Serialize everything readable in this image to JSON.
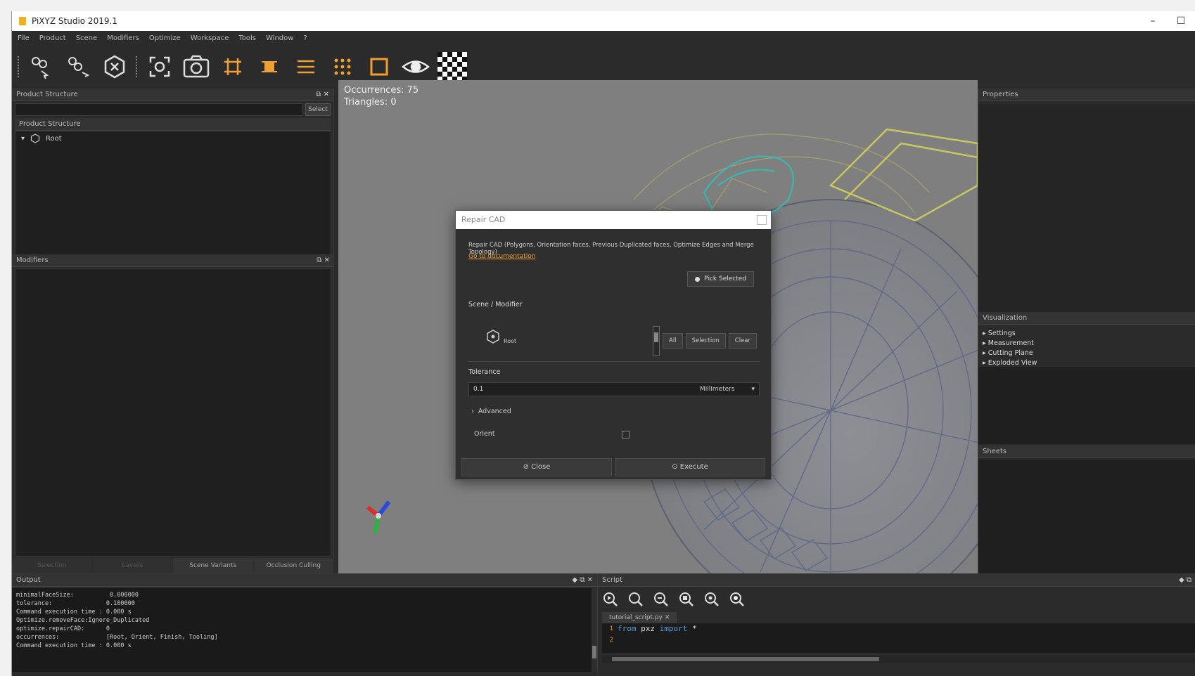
{
  "window": {
    "title": "PiXYZ Studio 2019.1"
  },
  "menu": [
    "File",
    "Product",
    "Scene",
    "Modifiers",
    "Optimize",
    "Workspace",
    "Tools",
    "Window",
    "?"
  ],
  "panels": {
    "product_structure_search": "Product Structure",
    "search_button": "Select",
    "product_structure_tab": "Product Structure",
    "tree_root": "Root",
    "modifiers": "Modifiers",
    "left_tabs": [
      "Selection",
      "Layers",
      "Scene Variants",
      "Occlusion Culling"
    ],
    "properties": "Properties",
    "visualization": "Visualization",
    "visualization_items": [
      "Settings",
      "Measurement",
      "Cutting Plane",
      "Exploded View"
    ],
    "sheets": "Sheets",
    "output": "Output",
    "script": "Script"
  },
  "viewport": {
    "occurrences_label": "Occurrences: 75",
    "triangles_label": "Triangles: 0"
  },
  "dialog": {
    "title": "Repair CAD",
    "description": "Repair CAD (Polygons, Orientation faces, Previous Duplicated faces, Optimize Edges and Merge Topology)",
    "doc_link": "Go to documentation",
    "pick_button": "Pick Selected",
    "occurrences_label": "Scene / Modifier",
    "occurrence_root": "Root",
    "occ_buttons": [
      "All",
      "Selection",
      "Clear"
    ],
    "tolerance_label": "Tolerance",
    "tolerance_value": "0.1",
    "tolerance_unit": "Millimeters",
    "advanced_label": "Advanced",
    "orient_label": "Orient",
    "cancel_button": "Close",
    "execute_button": "Execute"
  },
  "output_log": [
    "minimalFaceSize:          0.000000",
    "tolerance:               0.100000",
    "Command execution time : 0.000 s",
    "",
    "Optimize.removeFace:Ignore_Duplicated",
    "optimize.repairCAD:      0",
    "occurrences:             [Root, Orient, Finish, Tooling]",
    "Command execution time : 0.000 s"
  ],
  "script": {
    "tab": "tutorial_script.py",
    "lines": [
      {
        "num": "1",
        "kw1": "from",
        "mod": "pxz",
        "kw2": "import",
        "rest": "*"
      },
      {
        "num": "2",
        "kw1": "",
        "mod": "",
        "kw2": "",
        "rest": ""
      }
    ]
  },
  "colors": {
    "accent": "#f0a030",
    "background": "#2b2b2b",
    "viewport": "#7f7f7f"
  }
}
